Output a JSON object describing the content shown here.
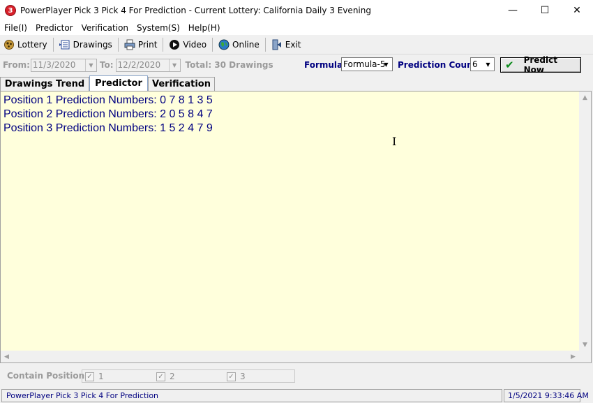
{
  "window": {
    "title": "PowerPlayer Pick 3 Pick 4 For Prediction - Current Lottery: California Daily 3 Evening",
    "icon_glyph": "3",
    "minimize_glyph": "—",
    "maximize_glyph": "☐",
    "close_glyph": "✕"
  },
  "menu": [
    "File(I)",
    "Predictor",
    "Verification",
    "System(S)",
    "Help(H)"
  ],
  "toolbar": {
    "lottery": "Lottery",
    "drawings": "Drawings",
    "print": "Print",
    "video": "Video",
    "online": "Online",
    "exit": "Exit"
  },
  "filter": {
    "from_label": "From:",
    "from_value": "11/3/2020",
    "to_label": "To:",
    "to_value": "12/2/2020",
    "total": "Total: 30 Drawings",
    "formula_label": "Formula:",
    "formula_value": "Formula-5",
    "count_label": "Prediction Count:",
    "count_value": "6",
    "predict_button": "Predict Now"
  },
  "tabs": [
    "Drawings Trend",
    "Predictor",
    "Verification"
  ],
  "active_tab": "Predictor",
  "results": [
    "Position 1 Prediction Numbers: 0 7 8 1 3 5",
    "Position 2 Prediction Numbers: 2 0 5 8 4 7",
    "Position 3 Prediction Numbers: 1 5 2 4 7 9"
  ],
  "positions": {
    "label": "Contain Positions:",
    "items": [
      "1",
      "2",
      "3"
    ],
    "checked": [
      true,
      true,
      true
    ]
  },
  "status": {
    "app_name": "PowerPlayer Pick 3 Pick 4 For Prediction",
    "datetime": "1/5/2021 9:33:46 AM"
  },
  "colors": {
    "content_bg": "#ffffdc",
    "text_navy": "#000080",
    "check_green": "#0a8a1a"
  }
}
